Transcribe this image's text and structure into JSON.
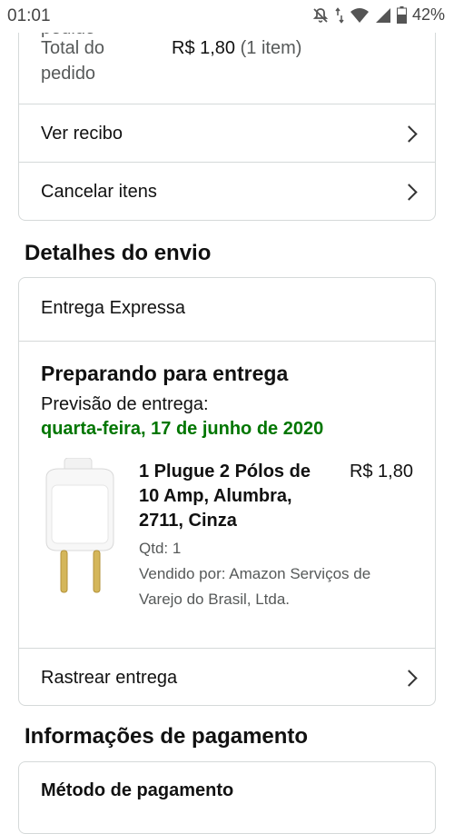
{
  "status_bar": {
    "time": "01:01",
    "battery": "42%",
    "icons": [
      "muted-notification-icon",
      "data-arrows-icon",
      "wifi-icon",
      "signal-icon",
      "battery-icon"
    ]
  },
  "order_summary": {
    "partial_label": "pedido",
    "total_label_line1": "Total do",
    "total_label_line2": "pedido",
    "total_value": "R$ 1,80",
    "total_items": "(1 item)",
    "ver_recibo": "Ver recibo",
    "cancelar_itens": "Cancelar itens"
  },
  "shipping": {
    "section_title": "Detalhes do envio",
    "method": "Entrega Expressa",
    "status_title": "Preparando para entrega",
    "forecast_label": "Previsão de entrega:",
    "forecast_date": "quarta-feira, 17 de junho de 2020",
    "item": {
      "title_line1": "1 Plugue 2 Pólos de",
      "title_line2": "10 Amp, Alumbra,",
      "title_line3": "2711, Cinza",
      "price": "R$ 1,80",
      "qty": "Qtd: 1",
      "seller_line1": "Vendido por: Amazon Serviços de",
      "seller_line2": "Varejo do Brasil, Ltda."
    },
    "track_label": "Rastrear entrega"
  },
  "payment": {
    "section_title": "Informações de pagamento",
    "method_label": "Método de pagamento"
  },
  "colors": {
    "green": "#007600",
    "border": "#d5d9d9",
    "muted": "#565959"
  }
}
